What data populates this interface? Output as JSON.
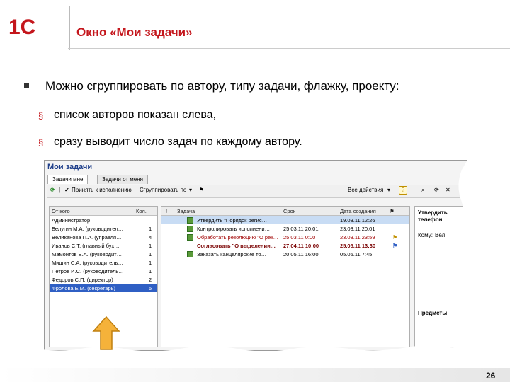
{
  "slide": {
    "title": "Окно «Мои задачи»",
    "bullet": "Можно сгруппировать по автору, типу задачи, флажку, проекту:",
    "subbullets": [
      "список авторов показан слева,",
      "сразу выводит число задач по каждому автору."
    ],
    "page_number": "26",
    "logo_text": "1С",
    "accent_color": "#c4161c"
  },
  "window": {
    "title": "Мои задачи",
    "tabs": [
      "Задачи мне",
      "Задачи от меня"
    ],
    "toolbar": {
      "accept": "Принять к исполнению",
      "group_label": "Сгруппировать по",
      "all_actions": "Все действия",
      "help": "?"
    },
    "authors_header": {
      "from": "От кого",
      "count": "Кол."
    },
    "authors": [
      {
        "name": "Администратор",
        "count": ""
      },
      {
        "name": "Белугин М.А. (руководител…",
        "count": "1"
      },
      {
        "name": "Великанова П.А. (управля…",
        "count": "4"
      },
      {
        "name": "Иванов С.Т. (главный бух…",
        "count": "1"
      },
      {
        "name": "Мамонтов Е.А. (руководит…",
        "count": "1"
      },
      {
        "name": "Мишин С.А. (руководитель…",
        "count": "1"
      },
      {
        "name": "Петров И.С. (руководитель…",
        "count": "1"
      },
      {
        "name": "Федоров С.П. (директор)",
        "count": "2"
      },
      {
        "name": "Фролова Е.М. (секретарь)",
        "count": "5"
      }
    ],
    "tasks_header": {
      "flag": "!",
      "task": "Задача",
      "due": "Срок",
      "created": "Дата создания"
    },
    "tasks": [
      {
        "task": "Утвердить \"Порядок регис…",
        "due": "",
        "created": "19.03.11 12:26",
        "style": "hl"
      },
      {
        "task": "Контролировать исполнени…",
        "due": "25.03.11 20:01",
        "created": "23.03.11 20:01",
        "style": ""
      },
      {
        "task": "Обработать резолюцию \"О рек…",
        "due": "25.03.11 0:00",
        "created": "23.03.11 23:59",
        "style": "red"
      },
      {
        "task": "Согласовать \"О выделении…",
        "due": "27.04.11 10:00",
        "created": "25.05.11 13:30",
        "style": "bold"
      },
      {
        "task": "Заказать канцелярские то…",
        "due": "20.05.11 16:00",
        "created": "05.05.11 7:45",
        "style": ""
      }
    ],
    "preview": {
      "title": "Утвердить",
      "subtitle": "телефон",
      "to_label": "Кому:",
      "to_value": "Вел",
      "subjects": "Предметы"
    }
  }
}
